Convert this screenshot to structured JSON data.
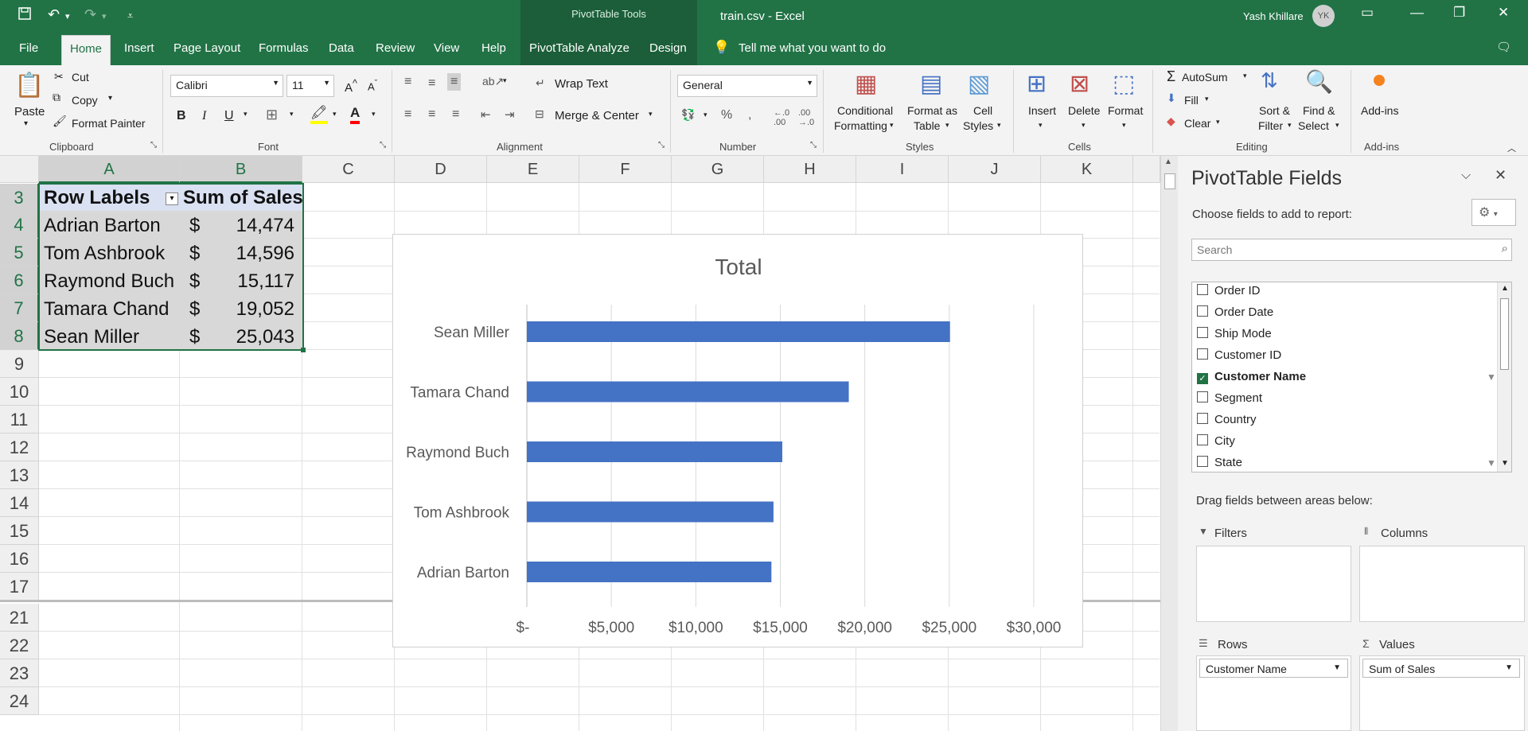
{
  "titlebar": {
    "doc_title": "train.csv  -  Excel",
    "context_tab_group": "PivotTable Tools",
    "user_name": "Yash Khillare",
    "user_initials": "YK",
    "save_icon": "save-icon",
    "undo_icon": "undo-icon",
    "redo_icon": "redo-icon"
  },
  "tabs": [
    "File",
    "Home",
    "Insert",
    "Page Layout",
    "Formulas",
    "Data",
    "Review",
    "View",
    "Help",
    "PivotTable Analyze",
    "Design"
  ],
  "active_tab": "Home",
  "tell_me": "Tell me what you want to do",
  "ribbon": {
    "clipboard": {
      "paste": "Paste",
      "cut": "Cut",
      "copy": "Copy",
      "format_painter": "Format Painter",
      "group": "Clipboard"
    },
    "font": {
      "name": "Calibri",
      "size": "11",
      "group": "Font",
      "bold": "B",
      "italic": "I",
      "underline": "U"
    },
    "alignment": {
      "wrap": "Wrap Text",
      "merge": "Merge & Center",
      "group": "Alignment"
    },
    "number": {
      "format": "General",
      "group": "Number"
    },
    "styles": {
      "conditional": "Conditional",
      "conditional2": "Formatting",
      "format_table": "Format as",
      "format_table2": "Table",
      "cell_styles": "Cell",
      "cell_styles2": "Styles",
      "group": "Styles"
    },
    "cells": {
      "insert": "Insert",
      "delete": "Delete",
      "format": "Format",
      "group": "Cells"
    },
    "editing": {
      "autosum": "AutoSum",
      "fill": "Fill",
      "clear": "Clear",
      "sort": "Sort &",
      "sort2": "Filter",
      "find": "Find &",
      "find2": "Select",
      "group": "Editing"
    },
    "addins": {
      "label": "Add-ins",
      "group": "Add-ins"
    }
  },
  "sheet": {
    "columns": [
      "A",
      "B",
      "C",
      "D",
      "E",
      "F",
      "G",
      "H",
      "I",
      "J",
      "K"
    ],
    "rows": [
      "3",
      "4",
      "5",
      "6",
      "7",
      "8",
      "9",
      "10",
      "11",
      "12",
      "13",
      "14",
      "15",
      "16",
      "17",
      "21",
      "22",
      "23",
      "24"
    ],
    "header": {
      "row_labels": "Row Labels",
      "sum_of_sales": "Sum of Sales"
    },
    "currency": "$",
    "data_rows": [
      {
        "name": "Adrian Barton",
        "value": "14,474"
      },
      {
        "name": "Tom Ashbrook",
        "value": "14,596"
      },
      {
        "name": "Raymond Buch",
        "value": "15,117"
      },
      {
        "name": "Tamara Chand",
        "value": "19,052"
      },
      {
        "name": "Sean Miller",
        "value": "25,043"
      }
    ]
  },
  "chart_data": {
    "type": "bar",
    "orientation": "horizontal",
    "title": "Total",
    "categories": [
      "Sean Miller",
      "Tamara Chand",
      "Raymond Buch",
      "Tom Ashbrook",
      "Adrian Barton"
    ],
    "values": [
      25043,
      19052,
      15117,
      14596,
      14474
    ],
    "xlim": [
      0,
      30000
    ],
    "xticks": [
      "$-",
      "$5,000",
      "$10,000",
      "$15,000",
      "$20,000",
      "$25,000",
      "$30,000"
    ],
    "bar_color": "#4472c4",
    "grid": true
  },
  "panel": {
    "title": "PivotTable Fields",
    "choose": "Choose fields to add to report:",
    "search_placeholder": "Search",
    "fields": [
      {
        "name": "Order ID",
        "checked": false
      },
      {
        "name": "Order Date",
        "checked": false
      },
      {
        "name": "Ship Mode",
        "checked": false
      },
      {
        "name": "Customer ID",
        "checked": false
      },
      {
        "name": "Customer Name",
        "checked": true
      },
      {
        "name": "Segment",
        "checked": false
      },
      {
        "name": "Country",
        "checked": false
      },
      {
        "name": "City",
        "checked": false
      },
      {
        "name": "State",
        "checked": false
      }
    ],
    "drag_text": "Drag fields between areas below:",
    "filters": "Filters",
    "columns": "Columns",
    "rows": "Rows",
    "values": "Values",
    "rows_value": "Customer Name",
    "values_value": "Sum of Sales"
  },
  "colors": {
    "accent": "#217346",
    "pivot_header": "#d9e1f2",
    "bar": "#4472c4"
  }
}
